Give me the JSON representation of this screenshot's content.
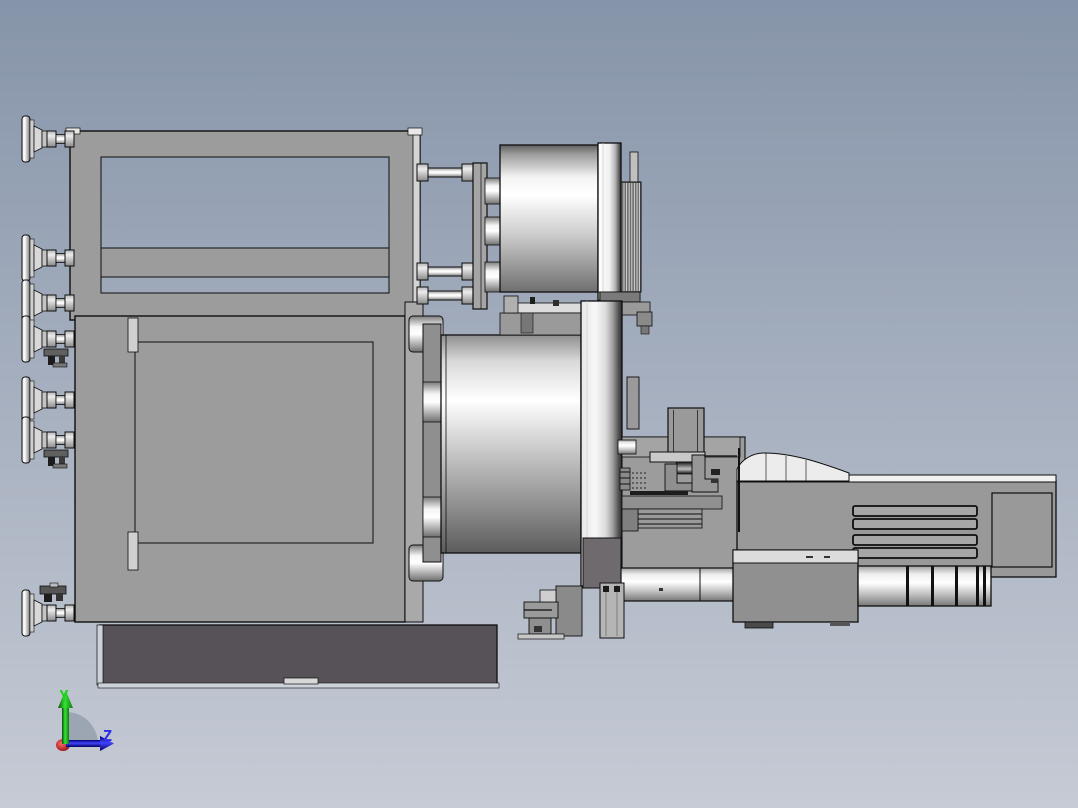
{
  "viewport": {
    "background_top": "#8694a9",
    "background_middle": "#aab3c2",
    "background_bottom": "#c6cbd5",
    "edge_color": "#0e0e0e",
    "body_gray": "#9c9c9c",
    "base_plate_color": "#575257"
  },
  "triad": {
    "y_label": "Y",
    "z_label": "Z",
    "y_color": "#21d121",
    "z_color": "#2d2de8",
    "origin_color": "#cc1111",
    "arc_color": "#98a1ae"
  }
}
